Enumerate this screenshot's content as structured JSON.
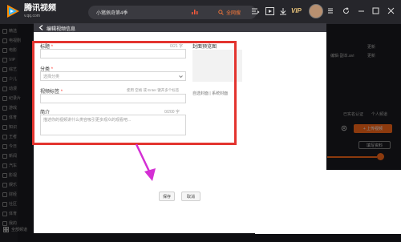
{
  "app": {
    "logo_cn": "腾讯视频",
    "logo_en": "v.qq.com",
    "search_placeholder": "小猪佩奇第4季",
    "search_button": "全网搜",
    "vip": "VIP"
  },
  "sidebar": {
    "items": [
      "精选",
      "电视剧",
      "电影",
      "VIP",
      "综艺",
      "少儿",
      "动漫",
      "纪录片",
      "游戏",
      "体育",
      "知识",
      "王者",
      "今日",
      "新闻",
      "汽车",
      "影视",
      "娱乐",
      "财经",
      "社区",
      "体育",
      "我的"
    ],
    "bottom_label": "全部频道"
  },
  "right_panel": {
    "line1": "更新",
    "line2": "编辑·副本.avi",
    "line3": "已实名认证",
    "line4": "个人频道",
    "upload_button": "+ 上传视频",
    "fill_button": "填写资料"
  },
  "modal": {
    "title": "编辑视频信息",
    "title_label": "标题",
    "title_counter": "0/21 字",
    "cover_label": "封面预览图",
    "category_label": "分类",
    "category_value": "选择分类",
    "tags_label": "视频标签",
    "tags_hint": "使用 空格 或 Enter 键开多个标签",
    "cover_links": "自选封面 | 系统封面",
    "desc_label": "简介",
    "desc_counter": "0/200 字",
    "desc_placeholder": "描述你的视频讲什么类容吸引更多观众的观看吧...",
    "save_button": "保存",
    "cancel_button": "取消"
  },
  "colors": {
    "accent": "#ff6b1a",
    "annotation": "#e3342f",
    "arrow": "#d42fd4"
  }
}
